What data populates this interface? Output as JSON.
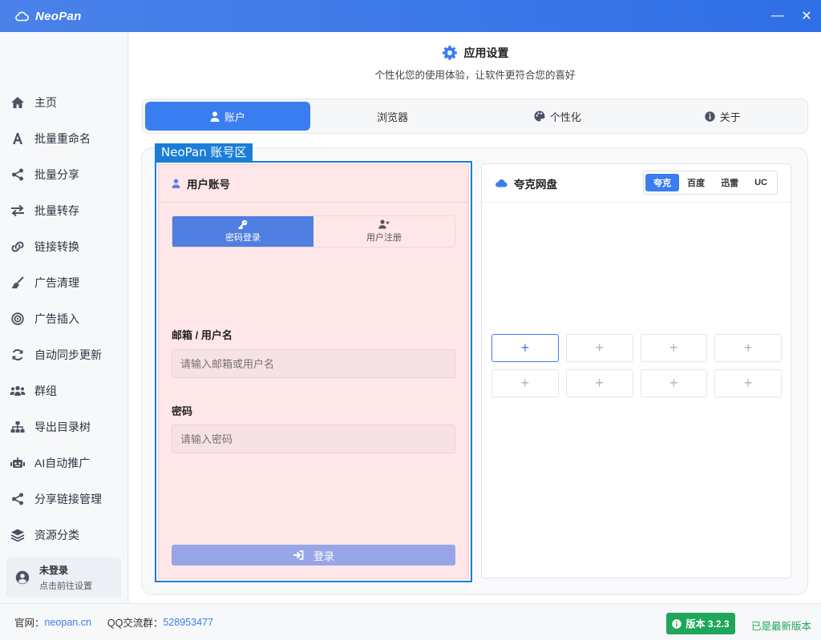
{
  "app": {
    "name": "NeoPan"
  },
  "window": {
    "minimize": "—",
    "close": "✕"
  },
  "sidebar": {
    "items": [
      {
        "label": "主页",
        "icon": "home-icon"
      },
      {
        "label": "批量重命名",
        "icon": "font-icon"
      },
      {
        "label": "批量分享",
        "icon": "share-icon"
      },
      {
        "label": "批量转存",
        "icon": "exchange-icon"
      },
      {
        "label": "链接转换",
        "icon": "link-icon"
      },
      {
        "label": "广告清理",
        "icon": "broom-icon"
      },
      {
        "label": "广告插入",
        "icon": "bullseye-icon"
      },
      {
        "label": "自动同步更新",
        "icon": "sync-icon"
      },
      {
        "label": "群组",
        "icon": "users-icon"
      },
      {
        "label": "导出目录树",
        "icon": "sitemap-icon"
      },
      {
        "label": "AI自动推广",
        "icon": "robot-icon"
      },
      {
        "label": "分享链接管理",
        "icon": "share-alt-icon"
      },
      {
        "label": "资源分类",
        "icon": "layers-icon"
      }
    ],
    "user": {
      "status": "未登录",
      "hint": "点击前往设置"
    }
  },
  "header": {
    "title": "应用设置",
    "subtitle": "个性化您的使用体验，让软件更符合您的喜好"
  },
  "tabs": [
    {
      "label": "账户",
      "icon": "user-icon",
      "active": true
    },
    {
      "label": "浏览器",
      "icon": "",
      "active": false
    },
    {
      "label": "个性化",
      "icon": "palette-icon",
      "active": false
    },
    {
      "label": "关于",
      "icon": "info-icon",
      "active": false
    }
  ],
  "highlight": {
    "label": "NeoPan 账号区"
  },
  "account": {
    "title": "用户账号",
    "modes": [
      {
        "label": "密码登录",
        "icon": "key-icon",
        "active": true
      },
      {
        "label": "用户注册",
        "icon": "user-plus-icon",
        "active": false
      }
    ],
    "email_label": "邮箱 / 用户名",
    "email_placeholder": "请输入邮箱或用户名",
    "password_label": "密码",
    "password_placeholder": "请输入密码",
    "login_button": "登录"
  },
  "drive": {
    "title": "夸克网盘",
    "providers": [
      {
        "label": "夸克",
        "active": true
      },
      {
        "label": "百度",
        "active": false
      },
      {
        "label": "迅雷",
        "active": false
      },
      {
        "label": "UC",
        "active": false
      }
    ],
    "slot_symbol": "+"
  },
  "footer": {
    "site_label": "官网：",
    "site_value": "neopan.cn",
    "qq_label": "QQ交流群：",
    "qq_value": "528953477",
    "version": "版本 3.2.3",
    "latest": "已是最新版本"
  },
  "colors": {
    "accent": "#3a7df0",
    "highlight": "#1a7ed8",
    "success": "#1fa65a"
  }
}
